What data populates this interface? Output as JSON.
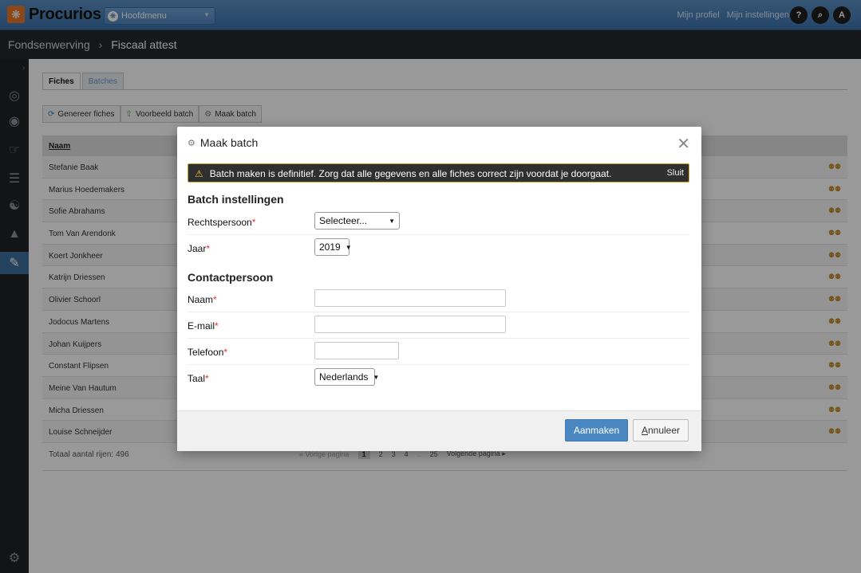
{
  "topbar": {
    "brand": "Procurios",
    "menu_label": "Hoofdmenu",
    "links": [
      "Mijn profiel",
      "Mijn instellingen"
    ],
    "help_label": "?",
    "search_label": "⌕",
    "avatar_label": "A"
  },
  "breadcrumb": {
    "parent": "Fondsenwerving",
    "separator": "›",
    "current": "Fiscaal attest"
  },
  "tabs": [
    {
      "label": "Fiches",
      "active": true
    },
    {
      "label": "Batches",
      "active": false
    }
  ],
  "toolbar": {
    "generate": "Genereer fiches",
    "preview": "Voorbeeld batch",
    "make": "Maak batch"
  },
  "table": {
    "header": "Naam",
    "rows": [
      "Stefanie Baak",
      "Marius Hoedemakers",
      "Sofie Abrahams",
      "Tom Van Arendonk",
      "Koert Jonkheer",
      "Katrijn Driessen",
      "Olivier Schoorl",
      "Jodocus Martens",
      "Johan Kuijpers",
      "Constant Flipsen",
      "Meine Van Hautum",
      "Micha Driessen",
      "Louise Schneijder"
    ],
    "total": "Totaal aantal rijen: 496",
    "pager": {
      "prev": "« Vorige pagina",
      "pages": [
        "1",
        "2",
        "3",
        "4",
        "..",
        "25"
      ],
      "next": "Volgende pagina ▸"
    }
  },
  "modal": {
    "title": "Maak batch",
    "warning": "Batch maken is definitief. Zorg dat alle gegevens en alle fiches correct zijn voordat je doorgaat.",
    "warning_close": "Sluit",
    "section1": "Batch instellingen",
    "rechtspersoon_label": "Rechtspersoon",
    "rechtspersoon_value": "Selecteer...",
    "jaar_label": "Jaar",
    "jaar_value": "2019",
    "section2": "Contactpersoon",
    "naam_label": "Naam",
    "email_label": "E-mail",
    "telefoon_label": "Telefoon",
    "taal_label": "Taal",
    "taal_value": "Nederlands",
    "required_mark": "*",
    "submit": "Aanmaken",
    "cancel": "Annuleer"
  },
  "colors": {
    "topbar": "#4a80b8",
    "primary_button": "#4b88c2",
    "warning_border": "#c9a227"
  }
}
